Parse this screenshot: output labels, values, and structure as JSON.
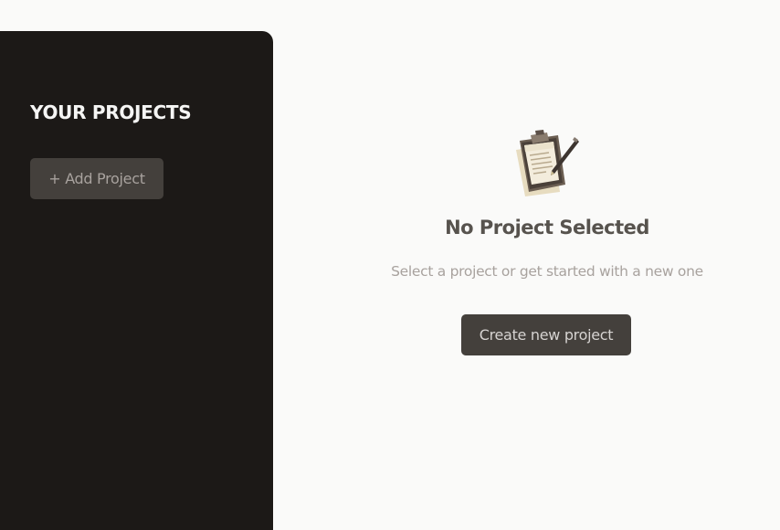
{
  "sidebar": {
    "title": "YOUR PROJECTS",
    "add_button_label": "+ Add Project"
  },
  "main": {
    "icon": "clipboard-icon",
    "empty_title": "No Project Selected",
    "empty_subtitle": "Select a project or get started with a new one",
    "create_button_label": "Create new project"
  },
  "colors": {
    "sidebar_bg": "#1c1917",
    "main_bg": "#fafaf9",
    "button_bg": "#44403c",
    "title_text": "#57534e",
    "muted_text": "#a8a29e"
  }
}
